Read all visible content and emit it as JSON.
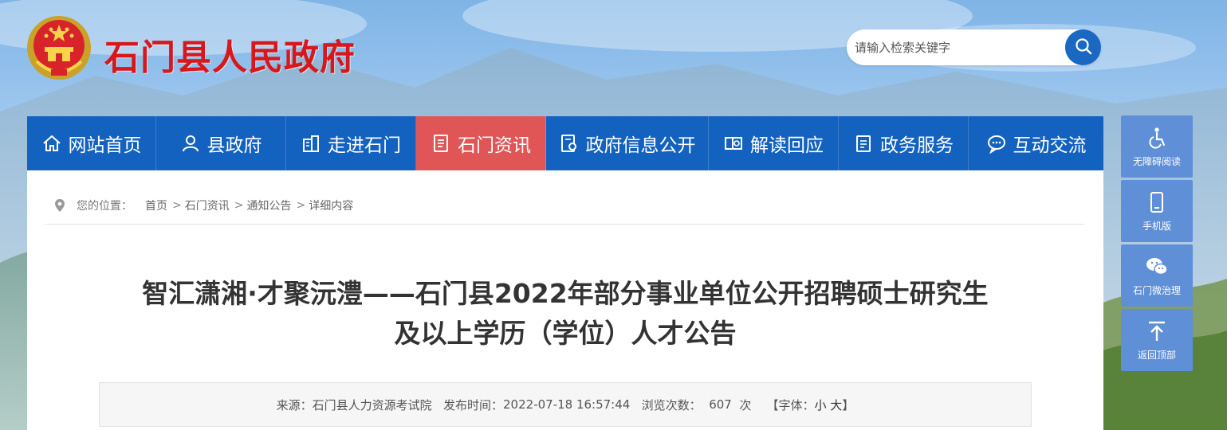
{
  "header": {
    "site_title": "石门县人民政府",
    "search_placeholder": "请输入检索关键字"
  },
  "nav": {
    "items": [
      {
        "label": "网站首页",
        "icon": "home-icon"
      },
      {
        "label": "县政府",
        "icon": "person-icon"
      },
      {
        "label": "走进石门",
        "icon": "building-icon"
      },
      {
        "label": "石门资讯",
        "icon": "news-icon",
        "active": true
      },
      {
        "label": "政府信息公开",
        "icon": "document-eye-icon"
      },
      {
        "label": "解读回应",
        "icon": "chat-book-icon"
      },
      {
        "label": "政务服务",
        "icon": "clipboard-icon"
      },
      {
        "label": "互动交流",
        "icon": "speech-bubble-icon"
      }
    ]
  },
  "breadcrumb": {
    "label": "您的位置：",
    "items": [
      "首页",
      "石门资讯",
      "通知公告",
      "详细内容"
    ],
    "separator": ">"
  },
  "article": {
    "title_line1": "智汇潇湘·才聚沅澧——石门县2022年部分事业单位公开招聘硕士研究生",
    "title_line2": "及以上学历（学位）人才公告",
    "meta": {
      "source_label": "来源：",
      "source": "石门县人力资源考试院",
      "time_label": "发布时间：",
      "time": "2022-07-18 16:57:44",
      "views_label": "浏览次数：",
      "views": "607",
      "views_unit": "次",
      "font_label_open": "【字体：",
      "font_small": "小",
      "font_large": "大",
      "font_label_close": "】"
    }
  },
  "float_toolbar": [
    {
      "label": "无障碍阅读",
      "icon": "accessibility-icon"
    },
    {
      "label": "手机版",
      "icon": "mobile-icon"
    },
    {
      "label": "石门微治理",
      "icon": "wechat-icon"
    },
    {
      "label": "返回顶部",
      "icon": "arrow-up-icon"
    }
  ],
  "colors": {
    "nav_bg": "#1462c0",
    "nav_active": "#e05657",
    "title_red": "#d7171b",
    "float_bg": "#5f8fd6"
  }
}
